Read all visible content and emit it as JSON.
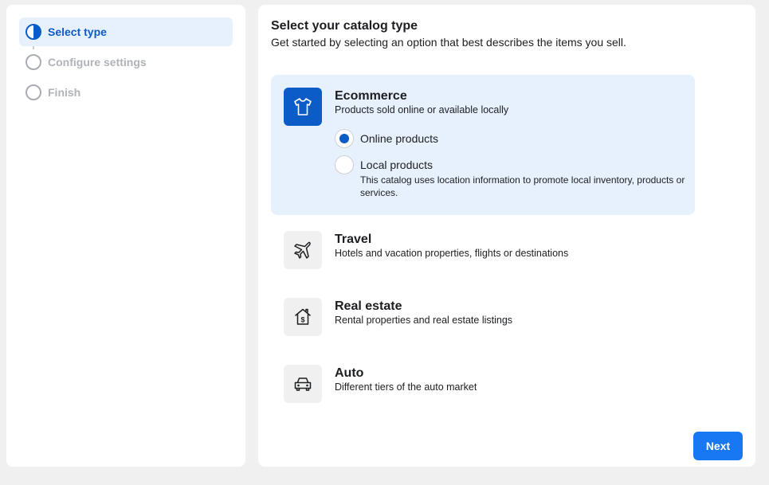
{
  "stepper": {
    "steps": [
      {
        "label": "Select type",
        "state": "active"
      },
      {
        "label": "Configure settings",
        "state": "inactive"
      },
      {
        "label": "Finish",
        "state": "inactive"
      }
    ]
  },
  "main": {
    "title": "Select your catalog type",
    "subtitle": "Get started by selecting an option that best describes the items you sell."
  },
  "options": [
    {
      "title": "Ecommerce",
      "description": "Products sold online or available locally",
      "icon": "tshirt-icon",
      "selected": true,
      "sub_options": [
        {
          "label": "Online products",
          "description": "",
          "checked": true
        },
        {
          "label": "Local products",
          "description": "This catalog uses location information to promote local inventory, products or services.",
          "checked": false
        }
      ]
    },
    {
      "title": "Travel",
      "description": "Hotels and vacation properties, flights or destinations",
      "icon": "airplane-icon",
      "selected": false
    },
    {
      "title": "Real estate",
      "description": "Rental properties and real estate listings",
      "icon": "house-dollar-icon",
      "selected": false
    },
    {
      "title": "Auto",
      "description": "Different tiers of the auto market",
      "icon": "car-icon",
      "selected": false
    }
  ],
  "actions": {
    "next_label": "Next"
  },
  "colors": {
    "accent": "#1877f2",
    "selected_bg": "#e7f1fd",
    "active_step": "#0b5cc7"
  }
}
